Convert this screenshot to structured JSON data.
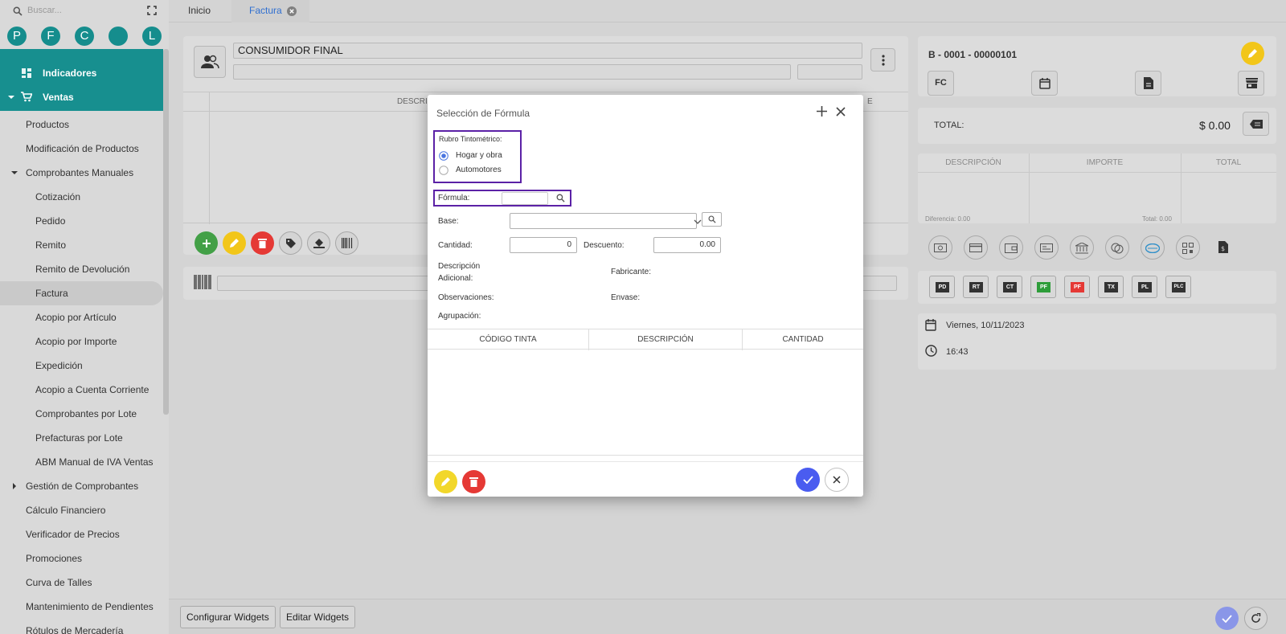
{
  "sidebar": {
    "search_placeholder": "Buscar...",
    "circles": [
      "P",
      "F",
      "C",
      "",
      "L"
    ],
    "top_items": {
      "indicadores": "Indicadores",
      "ventas": "Ventas"
    },
    "items": [
      {
        "label": "Productos",
        "level": 1
      },
      {
        "label": "Modificación de Productos",
        "level": 1
      },
      {
        "label": "Comprobantes Manuales",
        "level": 1,
        "expanded": true
      },
      {
        "label": "Cotización",
        "level": 2
      },
      {
        "label": "Pedido",
        "level": 2
      },
      {
        "label": "Remito",
        "level": 2
      },
      {
        "label": "Remito de Devolución",
        "level": 2
      },
      {
        "label": "Factura",
        "level": 2,
        "selected": true
      },
      {
        "label": "Acopio por Artículo",
        "level": 2
      },
      {
        "label": "Acopio por Importe",
        "level": 2
      },
      {
        "label": "Expedición",
        "level": 2
      },
      {
        "label": "Acopio a Cuenta Corriente",
        "level": 2
      },
      {
        "label": "Comprobantes por Lote",
        "level": 2
      },
      {
        "label": "Prefacturas por Lote",
        "level": 2
      },
      {
        "label": "ABM Manual de IVA Ventas",
        "level": 2
      },
      {
        "label": "Gestión de Comprobantes",
        "level": 1,
        "collapsed": true
      },
      {
        "label": "Cálculo Financiero",
        "level": 1
      },
      {
        "label": "Verificador de Precios",
        "level": 1
      },
      {
        "label": "Promociones",
        "level": 1
      },
      {
        "label": "Curva de Talles",
        "level": 1
      },
      {
        "label": "Mantenimiento de Pendientes",
        "level": 1
      },
      {
        "label": "Rótulos de Mercadería",
        "level": 1
      }
    ]
  },
  "tabs": {
    "inicio": "Inicio",
    "factura": "Factura"
  },
  "customer": {
    "name": "CONSUMIDOR FINAL"
  },
  "grid": {
    "header_desc": "DESCRI",
    "header_right": "E"
  },
  "invoice": {
    "number": "B - 0001 - 00000101",
    "type_label": "FC",
    "total_label": "TOTAL:",
    "total_value": "$ 0.00",
    "columns": [
      "DESCRIPCIÓN",
      "IMPORTE",
      "TOTAL"
    ],
    "diferencia": "Diferencia: 0.00",
    "total_small": "Total: 0.00",
    "doc_types": [
      "PD",
      "RT",
      "CT",
      "PF",
      "PF",
      "TX",
      "PL",
      "PLC"
    ],
    "date": "Viernes, 10/11/2023",
    "time": "16:43"
  },
  "footer": {
    "configurar": "Configurar Widgets",
    "editar": "Editar Widgets"
  },
  "dialog": {
    "title": "Selección de Fórmula",
    "rubro_label": "Rubro Tintométrico:",
    "options": [
      "Hogar y obra",
      "Automotores"
    ],
    "selected_option": 0,
    "formula_label": "Fórmula:",
    "base_label": "Base:",
    "cantidad_label": "Cantidad:",
    "cantidad_value": "0",
    "descuento_label": "Descuento:",
    "descuento_value": "0.00",
    "desc_adicional_1": "Descripción",
    "desc_adicional_2": "Adicional:",
    "fabricante_label": "Fabricante:",
    "observaciones_label": "Observaciones:",
    "envase_label": "Envase:",
    "agrupacion_label": "Agrupación:",
    "table_headers": [
      "CÓDIGO TINTA",
      "DESCRIPCIÓN",
      "CANTIDAD"
    ]
  },
  "colors": {
    "teal": "#178f8f",
    "green": "#43a047",
    "yellow": "#f2c619",
    "red": "#e53935",
    "blue": "#4a5cf0",
    "highlight": "#5b21a6"
  }
}
